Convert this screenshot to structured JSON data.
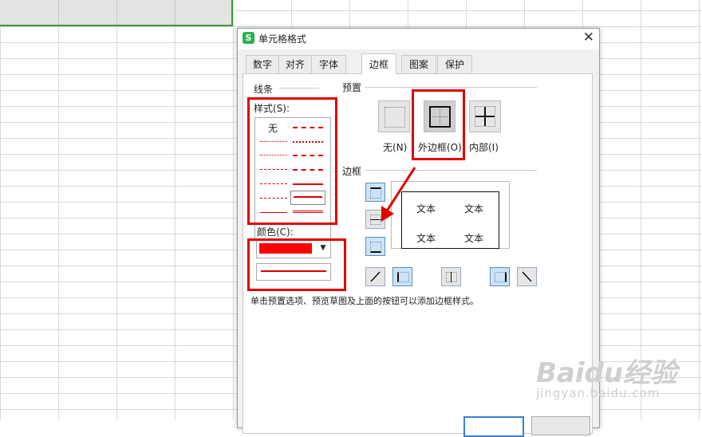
{
  "dialog": {
    "title": "单元格格式",
    "tabs": [
      "数字",
      "对齐",
      "字体",
      "边框",
      "图案",
      "保护"
    ],
    "active_tab": "边框"
  },
  "line": {
    "group_label": "线条",
    "style_label": "样式(S):",
    "style_none": "无",
    "color_label": "颜色(C):",
    "color_value": "#ff0000"
  },
  "presets": {
    "group_label": "预置",
    "items": [
      "无(N)",
      "外边框(O)",
      "内部(I)"
    ]
  },
  "border": {
    "group_label": "边框",
    "preview_text": [
      "文本",
      "文本",
      "文本",
      "文本"
    ]
  },
  "hint": "单击预置选项、预览草图及上面的按钮可以添加边框样式。",
  "watermark": {
    "brand": "Baidu经验",
    "url": "jingyan.baidu.com"
  }
}
